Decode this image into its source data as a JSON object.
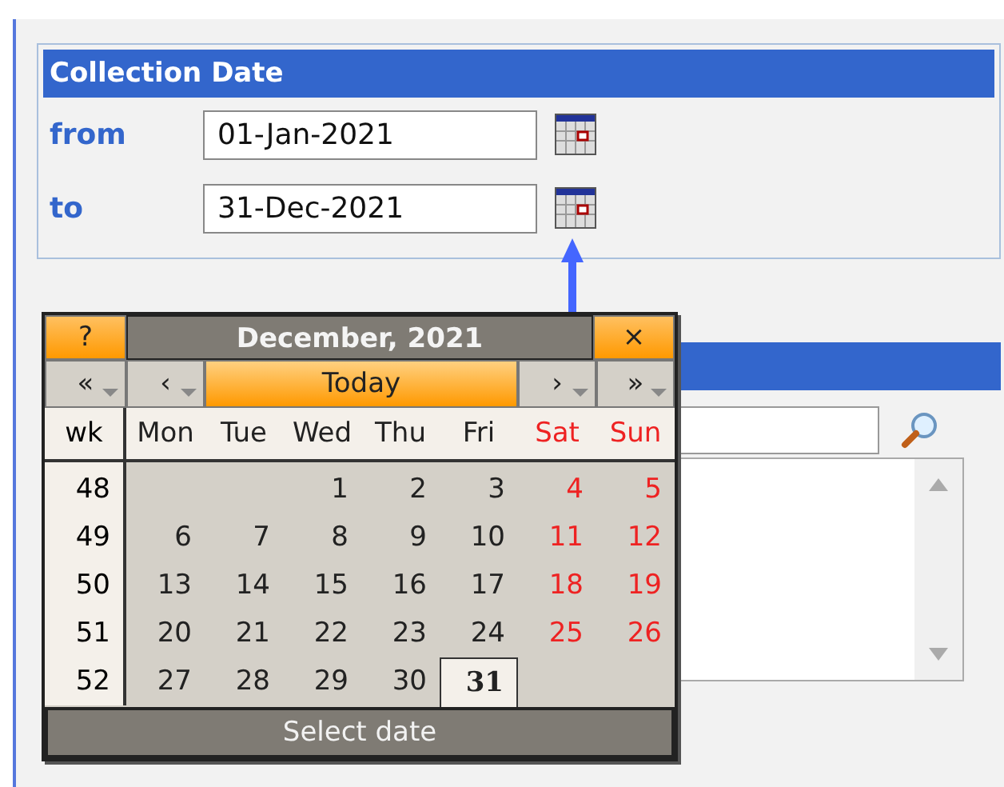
{
  "collection_date": {
    "title": "Collection Date",
    "fields": [
      {
        "label": "from",
        "value": "01-Jan-2021"
      },
      {
        "label": "to",
        "value": "31-Dec-2021"
      }
    ]
  },
  "calendar": {
    "help": "?",
    "title": "December, 2021",
    "close": "×",
    "nav": [
      {
        "kind": "arrow",
        "label": "«"
      },
      {
        "kind": "arrow",
        "label": "‹"
      },
      {
        "kind": "today",
        "label": "Today"
      },
      {
        "kind": "arrow",
        "label": "›"
      },
      {
        "kind": "arrow",
        "label": "»"
      }
    ],
    "week_heading": "wk",
    "weekdays": [
      {
        "label": "Mon",
        "weekend": false
      },
      {
        "label": "Tue",
        "weekend": false
      },
      {
        "label": "Wed",
        "weekend": false
      },
      {
        "label": "Thu",
        "weekend": false
      },
      {
        "label": "Fri",
        "weekend": false
      },
      {
        "label": "Sat",
        "weekend": true
      },
      {
        "label": "Sun",
        "weekend": true
      }
    ],
    "weeks": [
      {
        "wk": "48",
        "days": [
          {
            "kind": "blank"
          },
          {
            "kind": "blank"
          },
          {
            "kind": "day",
            "day": "1",
            "weekend": false,
            "selected": false
          },
          {
            "kind": "day",
            "day": "2",
            "weekend": false,
            "selected": false
          },
          {
            "kind": "day",
            "day": "3",
            "weekend": false,
            "selected": false
          },
          {
            "kind": "day",
            "day": "4",
            "weekend": true,
            "selected": false
          },
          {
            "kind": "day",
            "day": "5",
            "weekend": true,
            "selected": false
          }
        ]
      },
      {
        "wk": "49",
        "days": [
          {
            "kind": "day",
            "day": "6",
            "weekend": false,
            "selected": false
          },
          {
            "kind": "day",
            "day": "7",
            "weekend": false,
            "selected": false
          },
          {
            "kind": "day",
            "day": "8",
            "weekend": false,
            "selected": false
          },
          {
            "kind": "day",
            "day": "9",
            "weekend": false,
            "selected": false
          },
          {
            "kind": "day",
            "day": "10",
            "weekend": false,
            "selected": false
          },
          {
            "kind": "day",
            "day": "11",
            "weekend": true,
            "selected": false
          },
          {
            "kind": "day",
            "day": "12",
            "weekend": true,
            "selected": false
          }
        ]
      },
      {
        "wk": "50",
        "days": [
          {
            "kind": "day",
            "day": "13",
            "weekend": false,
            "selected": false
          },
          {
            "kind": "day",
            "day": "14",
            "weekend": false,
            "selected": false
          },
          {
            "kind": "day",
            "day": "15",
            "weekend": false,
            "selected": false
          },
          {
            "kind": "day",
            "day": "16",
            "weekend": false,
            "selected": false
          },
          {
            "kind": "day",
            "day": "17",
            "weekend": false,
            "selected": false
          },
          {
            "kind": "day",
            "day": "18",
            "weekend": true,
            "selected": false
          },
          {
            "kind": "day",
            "day": "19",
            "weekend": true,
            "selected": false
          }
        ]
      },
      {
        "wk": "51",
        "days": [
          {
            "kind": "day",
            "day": "20",
            "weekend": false,
            "selected": false
          },
          {
            "kind": "day",
            "day": "21",
            "weekend": false,
            "selected": false
          },
          {
            "kind": "day",
            "day": "22",
            "weekend": false,
            "selected": false
          },
          {
            "kind": "day",
            "day": "23",
            "weekend": false,
            "selected": false
          },
          {
            "kind": "day",
            "day": "24",
            "weekend": false,
            "selected": false
          },
          {
            "kind": "day",
            "day": "25",
            "weekend": true,
            "selected": false
          },
          {
            "kind": "day",
            "day": "26",
            "weekend": true,
            "selected": false
          }
        ]
      },
      {
        "wk": "52",
        "days": [
          {
            "kind": "day",
            "day": "27",
            "weekend": false,
            "selected": false
          },
          {
            "kind": "day",
            "day": "28",
            "weekend": false,
            "selected": false
          },
          {
            "kind": "day",
            "day": "29",
            "weekend": false,
            "selected": false
          },
          {
            "kind": "day",
            "day": "30",
            "weekend": false,
            "selected": false
          },
          {
            "kind": "day",
            "day": "31",
            "weekend": false,
            "selected": true
          },
          {
            "kind": "blank"
          },
          {
            "kind": "blank"
          }
        ]
      }
    ],
    "footer": "Select date"
  }
}
